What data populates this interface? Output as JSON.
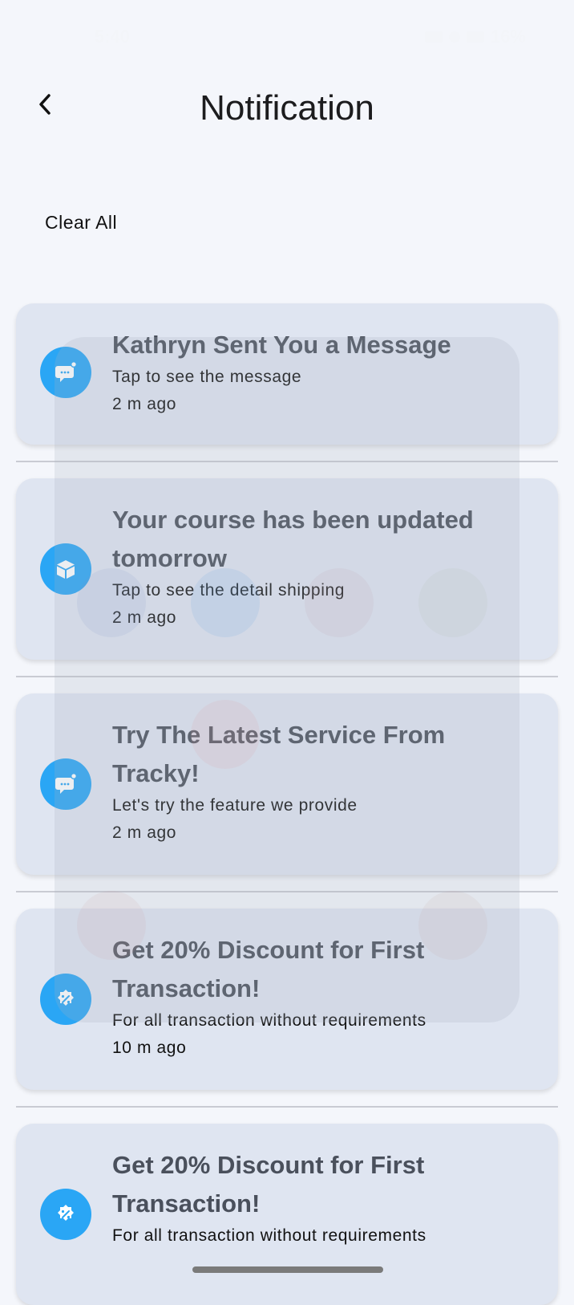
{
  "status_bar": {
    "time": "5:40",
    "battery": "16%"
  },
  "header": {
    "title": "Notification",
    "back_icon": "chevron-left-icon"
  },
  "actions": {
    "clear_all": "Clear All"
  },
  "colors": {
    "accent": "#2aa6f5",
    "card_bg": "#dfe5f1",
    "page_bg": "#f4f6fb",
    "title_text": "#4a505c"
  },
  "notifications": [
    {
      "icon": "chat-bubble-icon",
      "title": "Kathryn Sent You a Message",
      "subtitle": "Tap to see the message",
      "time": "2 m ago"
    },
    {
      "icon": "box-icon",
      "title": "Your course has been updated tomorrow",
      "subtitle": "Tap to see the detail shipping",
      "time": "2 m ago"
    },
    {
      "icon": "chat-bubble-icon",
      "title": "Try The Latest Service From Tracky!",
      "subtitle": "Let's try the feature we provide",
      "time": "2 m ago"
    },
    {
      "icon": "discount-badge-icon",
      "title": "Get 20% Discount for First Transaction!",
      "subtitle": "For all transaction without requirements",
      "time": "10 m ago"
    },
    {
      "icon": "discount-badge-icon",
      "title": "Get 20% Discount for First Transaction!",
      "subtitle": "For all transaction without requirements",
      "time": ""
    }
  ]
}
